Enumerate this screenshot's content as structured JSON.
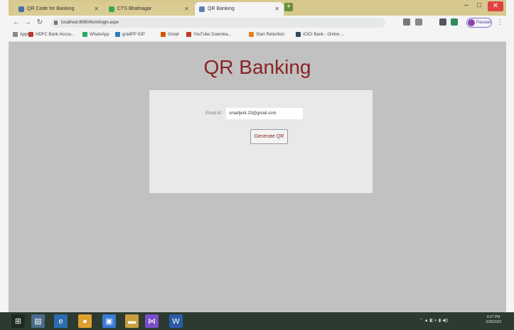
{
  "browser": {
    "tabs": [
      {
        "title": "QR Code for Banking",
        "active": false
      },
      {
        "title": "CTS Bhatnagar",
        "active": false
      },
      {
        "title": "QR Banking",
        "active": true
      }
    ],
    "address": "localhost:8080/form/login.aspx",
    "profile_label": "Paused",
    "bookmarks": [
      "Apps",
      "HDFC Bank Accou...",
      "WhatsApp",
      "gradPP IOP",
      "Gmail",
      "YouTube Downloa...",
      "Start Retention",
      "ICICI Bank - Online ..."
    ]
  },
  "page": {
    "title": "QR Banking",
    "email_label": "Email Id :",
    "email_value": "smartjerk.23@gmail.com",
    "button_label": "Generate QR"
  },
  "taskbar": {
    "clock_time": "4:27 PM",
    "clock_date": "3/28/2020"
  },
  "colors": {
    "title": "#8b2323",
    "background": "#c1c1c1",
    "card": "#e8e9e9",
    "tabbar": "#d7c88e"
  }
}
